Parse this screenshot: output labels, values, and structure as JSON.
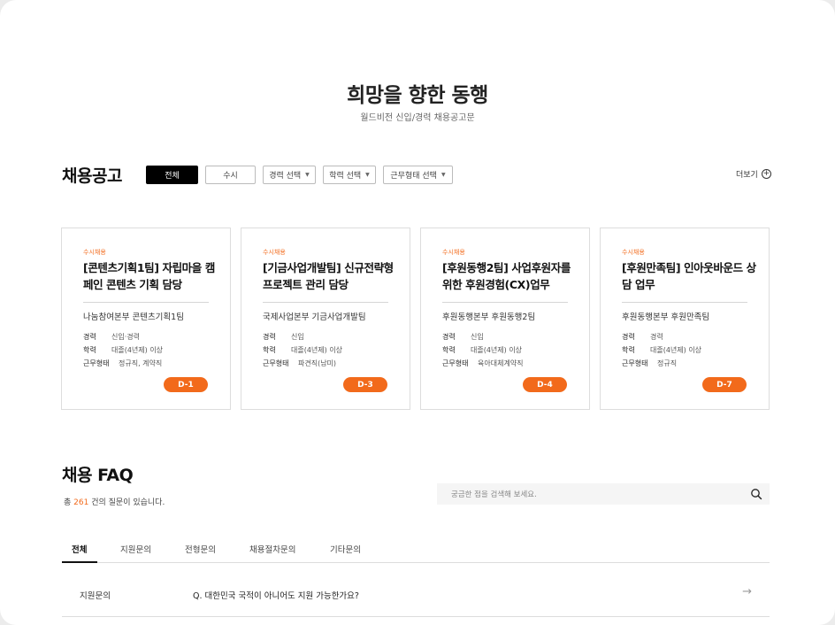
{
  "hero": {
    "title": "희망을 향한 동행",
    "subtitle": "월드비전 신입/경력 채용공고문"
  },
  "jobs": {
    "title": "채용공고",
    "filters": [
      {
        "label": "전체",
        "active": true
      },
      {
        "label": "수시",
        "active": false
      },
      {
        "label": "경력 선택",
        "active": false
      },
      {
        "label": "학력 선택",
        "active": false
      },
      {
        "label": "근무형태 선택",
        "active": false
      }
    ],
    "more_label": "더보기",
    "row_labels": {
      "career": "경력",
      "education": "학력",
      "work_type": "근무형태"
    },
    "cards": [
      {
        "tag": "수시채용",
        "title": "[콘텐츠기획1팀] 자립마을 캠페인 콘텐츠 기획 담당",
        "dept": "나눔참여본부 콘텐츠기획1팀",
        "career": "신입·경력",
        "education": "대졸(4년제) 이상",
        "work_type": "정규직, 계약직",
        "dday": "D-1"
      },
      {
        "tag": "수시채용",
        "title": "[기금사업개발팀] 신규전략형 프로젝트 관리 담당",
        "dept": "국제사업본부 기금사업개발팀",
        "career": "신입",
        "education": "대졸(4년제) 이상",
        "work_type": "파견직(남미)",
        "dday": "D-3"
      },
      {
        "tag": "수시채용",
        "title": "[후원동행2팀] 사업후원자를 위한 후원경험(CX)업무",
        "dept": "후원동행본부 후원동행2팀",
        "career": "신입",
        "education": "대졸(4년제) 이상",
        "work_type": "육아대체계약직",
        "dday": "D-4"
      },
      {
        "tag": "수시채용",
        "title": "[후원만족팀] 인아웃바운드 상담 업무",
        "dept": "후원동행본부 후원만족팀",
        "career": "경력",
        "education": "대졸(4년제) 이상",
        "work_type": "정규직",
        "dday": "D-7"
      }
    ]
  },
  "faq": {
    "title": "채용 FAQ",
    "count_prefix": "총",
    "count": "261",
    "count_suffix": "건의 질문이 있습니다.",
    "search_placeholder": "궁금한 점을 검색해 보세요.",
    "tabs": [
      "전체",
      "지원문의",
      "전형문의",
      "채용절차문의",
      "기타문의"
    ],
    "items": [
      {
        "category": "지원문의",
        "question": "Q.   대한민국 국적이 아니어도 지원 가능한가요?"
      }
    ]
  },
  "colors": {
    "accent": "#f26a1b",
    "active_filter_bg": "#000000"
  },
  "icons": {
    "search": "search-icon",
    "more": "plus-circle-icon",
    "faq_arrow": "arrow-right-icon"
  }
}
